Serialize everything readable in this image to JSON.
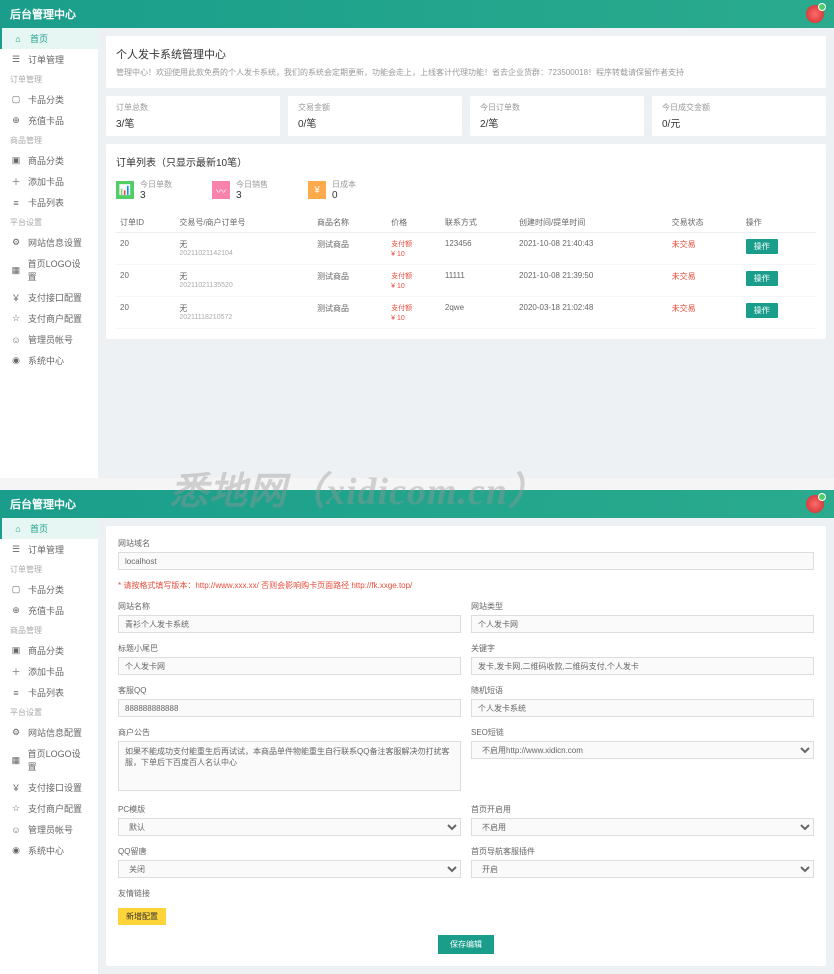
{
  "header": {
    "title": "后台管理中心"
  },
  "sidebar1": {
    "items": [
      {
        "label": "首页",
        "icon": "home"
      },
      {
        "label": "订单管理",
        "icon": "list"
      }
    ],
    "group1": "订单管理",
    "items2": [
      {
        "label": "卡品分类",
        "icon": "category"
      },
      {
        "label": "充值卡品",
        "icon": "add"
      }
    ],
    "group2": "商品管理",
    "items3": [
      {
        "label": "商品分类",
        "icon": "folder"
      },
      {
        "label": "添加卡品",
        "icon": "plus"
      },
      {
        "label": "卡品列表",
        "icon": "list"
      }
    ],
    "group3": "平台设置",
    "items4": [
      {
        "label": "网站信息设置",
        "icon": "settings"
      },
      {
        "label": "首页LOGO设置",
        "icon": "image"
      },
      {
        "label": "支付接口配置",
        "icon": "pay"
      },
      {
        "label": "支付商户配置",
        "icon": "merchant"
      },
      {
        "label": "管理员帐号",
        "icon": "user"
      },
      {
        "label": "系统中心",
        "icon": "system"
      }
    ]
  },
  "banner": {
    "title": "个人发卡系统管理中心",
    "sub": "管理中心！欢迎使用此款免费的个人发卡系统，我们的系统会定期更新，功能会走上，上线客计代理功能！省去企业货群：723500018！程序转载请保留作者支持"
  },
  "stats": [
    {
      "label": "订单总数",
      "value": "3/笔"
    },
    {
      "label": "交易金额",
      "value": "0/笔"
    },
    {
      "label": "今日订单数",
      "value": "2/笔"
    },
    {
      "label": "今日成交金额",
      "value": "0/元"
    }
  ],
  "panel": {
    "title": "订单列表（只显示最新10笔）",
    "stats": [
      {
        "label": "今日单数",
        "value": "3"
      },
      {
        "label": "今日销售",
        "value": "3"
      },
      {
        "label": "日成本",
        "value": "0"
      }
    ],
    "headers": [
      "订单ID",
      "交易号/商户订单号",
      "商品名称",
      "价格",
      "联系方式",
      "创建时间/提单时间",
      "交易状态",
      "操作"
    ],
    "rows": [
      {
        "id": "20",
        "name": "无",
        "order": "20211021142104",
        "product": "测试商品",
        "price_label": "支付额",
        "price": "¥ 10",
        "contact": "123456",
        "time1": "2021-10-08 21:40:43",
        "time2": "",
        "status": "未交易",
        "action": "操作"
      },
      {
        "id": "20",
        "name": "无",
        "order": "20211021135520",
        "product": "测试商品",
        "price_label": "支付额",
        "price": "¥ 10",
        "contact": "11111",
        "time1": "2021-10-08 21:39:50",
        "time2": "",
        "status": "未交易",
        "action": "操作"
      },
      {
        "id": "20",
        "name": "无",
        "order": "20211118210572",
        "product": "测试商品",
        "price_label": "支付额",
        "price": "¥ 10",
        "contact": "2qwe",
        "time1": "2020-03-18 21:02:48",
        "time2": "",
        "status": "未交易",
        "action": "操作"
      }
    ]
  },
  "watermark": "悉地网（xidicom.cn）",
  "sidebar2": {
    "items": [
      {
        "label": "首页",
        "icon": "home"
      },
      {
        "label": "订单管理",
        "icon": "list"
      }
    ],
    "group1": "订单管理",
    "items2": [
      {
        "label": "卡品分类",
        "icon": "category"
      },
      {
        "label": "充值卡品",
        "icon": "add"
      }
    ],
    "group2": "商品管理",
    "items3": [
      {
        "label": "商品分类",
        "icon": "folder"
      },
      {
        "label": "添加卡品",
        "icon": "plus"
      },
      {
        "label": "卡品列表",
        "icon": "list"
      }
    ],
    "group3": "平台设置",
    "items4": [
      {
        "label": "网站信息配置",
        "icon": "settings"
      },
      {
        "label": "首页LOGO设置",
        "icon": "image"
      },
      {
        "label": "支付接口设置",
        "icon": "pay"
      },
      {
        "label": "支付商户配置",
        "icon": "merchant"
      },
      {
        "label": "管理员帐号",
        "icon": "user"
      },
      {
        "label": "系统中心",
        "icon": "system"
      }
    ]
  },
  "form": {
    "domain_label": "网站域名",
    "domain_value": "localhost",
    "note": "* 请按格式填写版本：http://www.xxx.xx/ 否则会影响购卡页面路径 ",
    "note_link": "http://fk.xxge.top/",
    "title_label": "网站名称",
    "title_value": "青衫个人发卡系统",
    "type_label": "网站类型",
    "type_value": "个人发卡网",
    "subtitle_label": "标题小尾巴",
    "subtitle_value": "个人发卡网",
    "keywords_label": "关键字",
    "keywords_value": "发卡,发卡网,二维码收款,二维码支付,个人发卡",
    "qq_label": "客服QQ",
    "qq_value": "888888888888",
    "phrase_label": "随机短语",
    "phrase_value": "个人发卡系统",
    "announce_label": "商户公告",
    "announce_value": "如果不能成功支付能重生后再试试，本商品单件物能重生自行联系QQ备注客服解决勿打扰客服，下单后下百度百人名认中心",
    "short_label": "SEO短链",
    "short_value": "不启用http://www.xidicn.com",
    "pc_label": "PC模版",
    "pc_value": "默认",
    "home_label": "首页开启用",
    "home_value": "不启用",
    "qqpush_label": "QQ留唐",
    "qqpush_value": "关闭",
    "seo_label": "首页导航客服插件",
    "seo_value": "开启",
    "friend_label": "友情链接",
    "btn_save": "新增配置",
    "btn_submit": "保存编辑"
  }
}
